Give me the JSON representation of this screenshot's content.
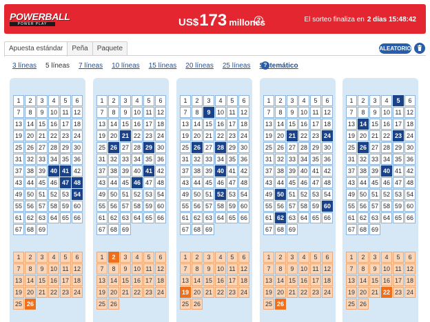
{
  "header": {
    "logo_top": "POWERBALL",
    "logo_bottom": "POWER PLAY",
    "jackpot_currency": "US$",
    "jackpot_amount": "173",
    "jackpot_unit": "millones",
    "help_glyph": "?",
    "draw_label": "El sorteo finaliza en",
    "draw_countdown": "2 días 15:48:42",
    "bg_color": "#e3262f"
  },
  "tabs": [
    {
      "label": "Apuesta estándar",
      "active": true
    },
    {
      "label": "Peña",
      "active": false
    },
    {
      "label": "Paquete",
      "active": false
    }
  ],
  "toolbar": {
    "random_label": "ALEATORIO",
    "trash_icon": "trash-icon"
  },
  "lines_options": [
    {
      "label": "3 líneas",
      "current": false
    },
    {
      "label": "5 líneas",
      "current": true
    },
    {
      "label": "7 líneas",
      "current": false
    },
    {
      "label": "10 líneas",
      "current": false
    },
    {
      "label": "15 líneas",
      "current": false
    },
    {
      "label": "20 líneas",
      "current": false
    },
    {
      "label": "25 líneas",
      "current": false
    },
    {
      "label": "Sistemático",
      "current": false
    }
  ],
  "lines_help_glyph": "?",
  "colors": {
    "accent_blue": "#1a428a",
    "powerball_orange": "#ee6f1c"
  },
  "main_range": 69,
  "powerball_range": 26,
  "tickets": [
    {
      "main_selected": [
        40,
        41,
        47,
        48,
        54
      ],
      "powerball_selected": [
        26
      ]
    },
    {
      "main_selected": [
        21,
        26,
        29,
        41,
        46
      ],
      "powerball_selected": [
        2
      ]
    },
    {
      "main_selected": [
        9,
        26,
        28,
        40,
        52
      ],
      "powerball_selected": [
        19
      ]
    },
    {
      "main_selected": [
        21,
        24,
        50,
        60,
        62
      ],
      "powerball_selected": [
        26
      ]
    },
    {
      "main_selected": [
        5,
        14,
        23,
        26,
        40
      ],
      "powerball_selected": [
        22
      ]
    }
  ]
}
